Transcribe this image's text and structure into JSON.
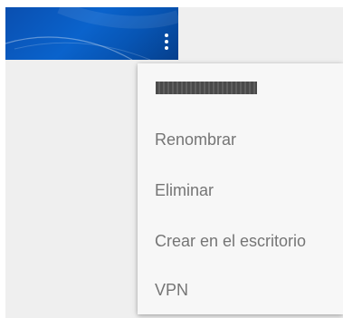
{
  "card": {
    "thumbnail_icon": "blue-wallpaper-thumbnail",
    "overflow_icon": "more-vert-icon"
  },
  "menu": {
    "header_redacted": true,
    "items": [
      {
        "label": "Renombrar"
      },
      {
        "label": "Eliminar"
      },
      {
        "label": "Crear en el escritorio"
      },
      {
        "label": "VPN"
      }
    ]
  },
  "colors": {
    "thumbnail": "#0a5cc4",
    "menu_background": "#f7f7f7",
    "menu_text": "#757575",
    "page_background": "#efefef"
  }
}
